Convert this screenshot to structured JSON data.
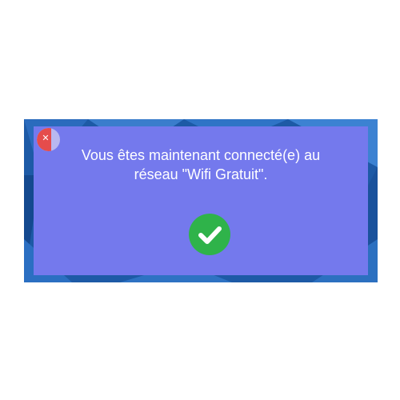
{
  "dialog": {
    "message_line1": "Vous êtes maintenant connecté(e) au",
    "message_line2": "réseau \"Wifi Gratuit\".",
    "close_icon": "close-icon",
    "status_icon": "checkmark-icon"
  },
  "colors": {
    "dialog_background": "#7479ed",
    "backdrop_blue": "#1d5aa6",
    "close_button_red": "#e54c4c",
    "success_green": "#2fb34a"
  }
}
